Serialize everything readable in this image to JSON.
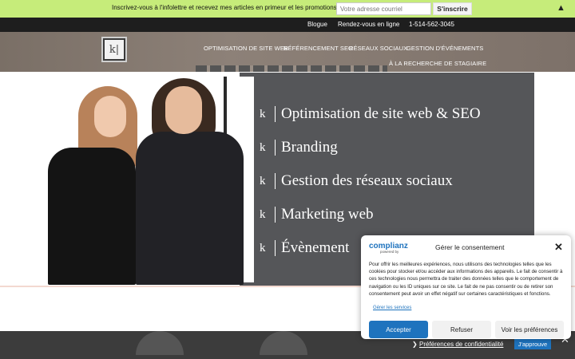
{
  "topbar": {
    "message": "Inscrivez-vous à l'infolettre et recevez mes articles en primeur et les promotions!",
    "email_placeholder": "Votre adresse courriel",
    "subscribe_label": "S'inscrire",
    "collapse_glyph": "▲"
  },
  "contact": {
    "blog": "Blogue",
    "appointment": "Rendez-vous en ligne",
    "phone": "1-514-562-3045"
  },
  "logo": {
    "glyph": "k|"
  },
  "nav": {
    "items": [
      "OPTIMISATION DE SITE WEB",
      "RÉFÉRENCEMENT SEO",
      "RÉSEAUX SOCIAUX",
      "GESTION D'ÉVÉNEMENTS",
      "À LA RECHERCHE DE STAGIAIRE"
    ]
  },
  "hero": {
    "bullet_glyph": "k",
    "services": [
      "Optimisation de site web & SEO",
      "Branding",
      "Gestion des réseaux sociaux",
      "Marketing web",
      "Évènement"
    ]
  },
  "cookiebar": {
    "prefs_label": "Préférences de confidentialité",
    "accept_label": "J'approuve",
    "close_glyph": "✕",
    "arrow_glyph": "❯"
  },
  "consent": {
    "brand": "complianz",
    "brand_sub": "powered by",
    "title": "Gérer le consentement",
    "close_glyph": "✕",
    "text": "Pour offrir les meilleures expériences, nous utilisons des technologies telles que les cookies pour stocker et/ou accéder aux informations des appareils. Le fait de consentir à ces technologies nous permettra de traiter des données telles que le comportement de navigation ou les ID uniques sur ce site. Le fait de ne pas consentir ou de retirer son consentement peut avoir un effet négatif sur certaines caractéristiques et fonctions.",
    "manage_link": "Gérer les services",
    "accept_label": "Accepter",
    "refuse_label": "Refuser",
    "prefs_label": "Voir les préférences"
  },
  "colors": {
    "topbar": "#c6ec7a",
    "accent": "#1e73be",
    "dark": "#1e1e1e"
  }
}
